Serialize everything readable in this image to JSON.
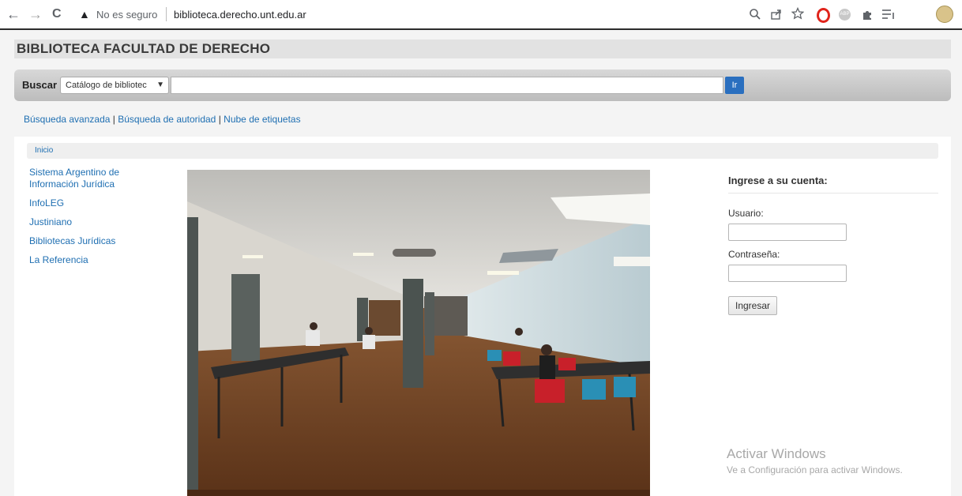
{
  "browser": {
    "back_icon": "←",
    "forward_icon": "→",
    "reload_icon": "C",
    "warning_icon": "▲",
    "security_text": "No es seguro",
    "url": "biblioteca.derecho.unt.edu.ar"
  },
  "site": {
    "title": "BIBLIOTECA FACULTAD DE DERECHO"
  },
  "search": {
    "label": "Buscar",
    "select_value": "Catálogo de bibliotec",
    "input_value": "",
    "go_label": "Ir"
  },
  "links": {
    "advanced": "Búsqueda avanzada",
    "authority": "Búsqueda de autoridad",
    "tags": "Nube de etiquetas",
    "separator": "|"
  },
  "breadcrumb": {
    "home": "Inicio"
  },
  "sidebar": {
    "items": [
      {
        "label_line1": "Sistema Argentino de",
        "label_line2": "Información Jurídica"
      },
      {
        "label_line1": "InfoLEG",
        "label_line2": ""
      },
      {
        "label_line1": "Justiniano",
        "label_line2": ""
      },
      {
        "label_line1": "Bibliotecas Jurídicas",
        "label_line2": ""
      },
      {
        "label_line1": "La Referencia",
        "label_line2": ""
      }
    ]
  },
  "login": {
    "title": "Ingrese a su cuenta:",
    "user_label": "Usuario:",
    "password_label": "Contraseña:",
    "submit_label": "Ingresar"
  },
  "watermark": {
    "line1": "Activar Windows",
    "line2": "Ve a Configuración para activar Windows."
  },
  "colors": {
    "link": "#1f6fb2",
    "go_button": "#2a6fbf"
  }
}
